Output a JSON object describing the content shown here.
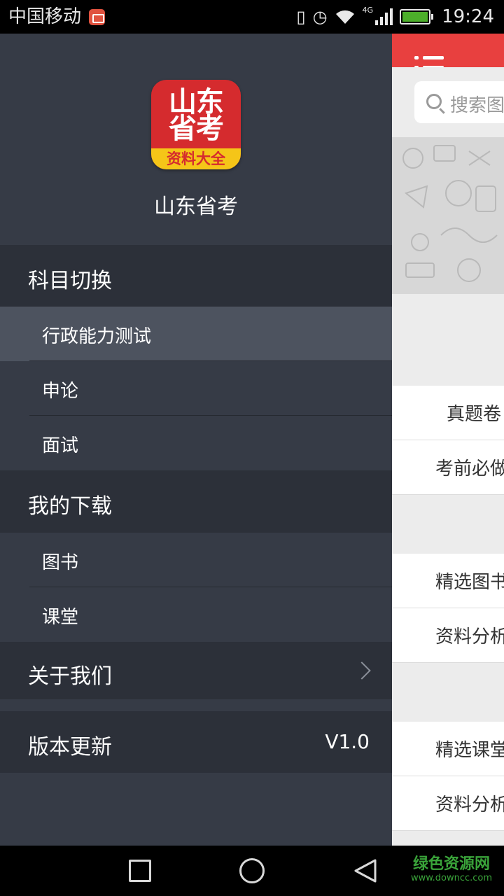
{
  "status_bar": {
    "carrier": "中国移动",
    "network": "4G",
    "time": "19:24"
  },
  "main_screen": {
    "search_placeholder": "搜索图",
    "rows": [
      "真题卷",
      "考前必做",
      "精选图书",
      "资料分析",
      "精选课堂",
      "资料分析"
    ],
    "accent_color": "#e8403f"
  },
  "drawer": {
    "logo": {
      "line1": "山东",
      "line2": "省考",
      "band": "资料大全"
    },
    "app_name": "山东省考",
    "sections": {
      "subject_switch": {
        "label": "科目切换",
        "items": [
          "行政能力测试",
          "申论",
          "面试"
        ],
        "selected": "行政能力测试"
      },
      "my_downloads": {
        "label": "我的下载",
        "items": [
          "图书",
          "课堂"
        ]
      },
      "about_us": {
        "label": "关于我们"
      },
      "version_update": {
        "label": "版本更新",
        "value": "V1.0"
      }
    }
  },
  "watermark": {
    "main": "绿色资源网",
    "sub": "www.downcc.com"
  }
}
